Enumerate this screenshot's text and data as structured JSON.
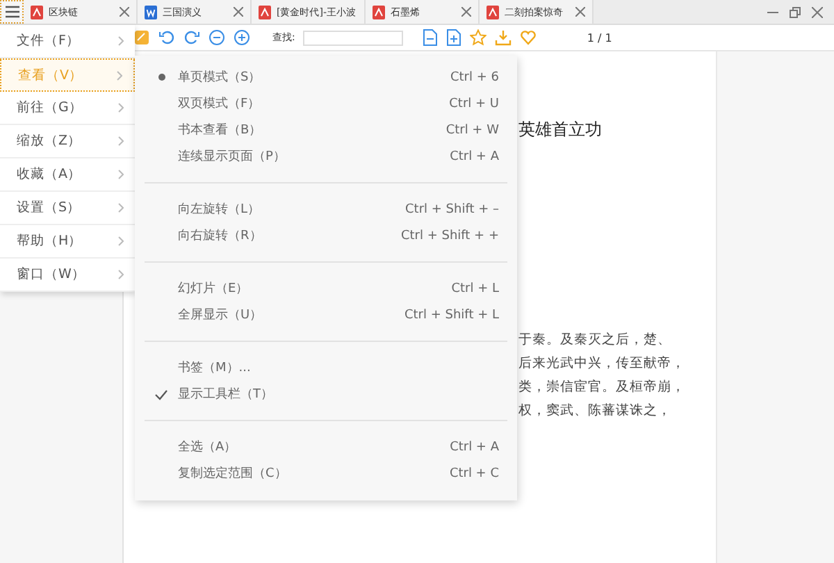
{
  "tabs": [
    {
      "label": "区块链",
      "kind": "pdf",
      "selected": false
    },
    {
      "label": "三国演义",
      "kind": "word",
      "selected": false
    },
    {
      "label": "[黄金时代]-王小波",
      "kind": "pdf",
      "selected": false
    },
    {
      "label": "石墨烯",
      "kind": "pdf",
      "selected": false
    },
    {
      "label": "二刻拍案惊奇",
      "kind": "pdf",
      "selected": false
    }
  ],
  "toolbar": {
    "search_label": "查找:",
    "page": "1 / 1"
  },
  "menu": [
    {
      "label": "文件（F）",
      "selected": false
    },
    {
      "label": "查看（V）",
      "selected": true
    },
    {
      "label": "前往（G）",
      "selected": false
    },
    {
      "label": "缩放（Z）",
      "selected": false
    },
    {
      "label": "收藏（A）",
      "selected": false
    },
    {
      "label": "设置（S）",
      "selected": false
    },
    {
      "label": "帮助（H）",
      "selected": false
    },
    {
      "label": "窗口（W）",
      "selected": false
    }
  ],
  "submenu": [
    [
      {
        "label": "单页模式（S）",
        "shortcut": "Ctrl + 6",
        "kind": "radio",
        "checked": true
      },
      {
        "label": "双页模式（F）",
        "shortcut": "Ctrl + U",
        "kind": "radio",
        "checked": false
      },
      {
        "label": "书本查看（B）",
        "shortcut": "Ctrl + W",
        "kind": "radio",
        "checked": false
      },
      {
        "label": "连续显示页面（P）",
        "shortcut": "Ctrl + A",
        "kind": "radio",
        "checked": false
      }
    ],
    [
      {
        "label": "向左旋转（L）",
        "shortcut": "Ctrl + Shift + –",
        "kind": "command"
      },
      {
        "label": "向右旋转（R）",
        "shortcut": "Ctrl + Shift + +",
        "kind": "command"
      }
    ],
    [
      {
        "label": "幻灯片（E）",
        "shortcut": "Ctrl + L",
        "kind": "command"
      },
      {
        "label": "全屏显示（U）",
        "shortcut": "Ctrl + Shift + L",
        "kind": "command"
      }
    ],
    [
      {
        "label": "书签（M）...",
        "kind": "command"
      },
      {
        "label": "显示工具栏（T）",
        "kind": "toggle",
        "checked": true
      }
    ],
    [
      {
        "label": "全选（A）",
        "shortcut": "Ctrl + A",
        "kind": "command"
      },
      {
        "label": "复制选定范围（C）",
        "shortcut": "Ctrl + C",
        "kind": "command"
      }
    ]
  ],
  "document": {
    "heading": "英雄首立功",
    "lines": [
      "于秦。及秦灭之后，楚、",
      "后来光武中兴，传至献帝，",
      "类，崇信宦官。及桓帝崩，",
      "权，窦武、陈蕃谋诛之，"
    ]
  }
}
